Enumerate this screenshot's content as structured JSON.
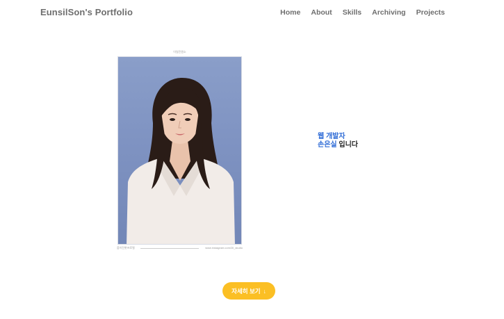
{
  "navbar": {
    "brand": "EunsilSon's Portfolio",
    "links": [
      "Home",
      "About",
      "Skills",
      "Archiving",
      "Projects"
    ]
  },
  "hero": {
    "photo_caption_top": "이일진원소",
    "photo_caption_bottom_left": "움이진롯프로필",
    "photo_caption_bottom_right": "www.instagram.com/2il_studio",
    "role": "웹 개발자",
    "name": "손은실",
    "suffix": " 입니다",
    "button_label": "자세히 보기",
    "button_icon": "↓"
  },
  "colors": {
    "accent": "#2e6bd6",
    "button": "#fbbf24",
    "photo_bg": "#8a9ec9"
  }
}
